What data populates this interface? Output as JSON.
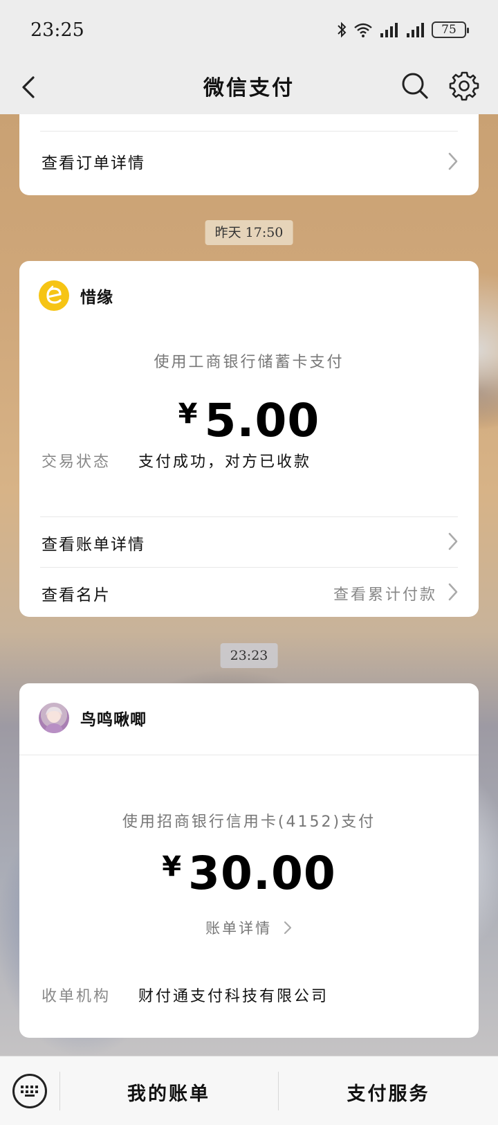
{
  "status_bar": {
    "time": "23:25",
    "battery": "75",
    "icons": [
      "bluetooth-icon",
      "wifi-icon",
      "signal-icon",
      "signal-icon"
    ]
  },
  "nav": {
    "title": "微信支付",
    "back_icon": "chevron-left-icon",
    "search_icon": "search-icon",
    "settings_icon": "gear-icon"
  },
  "card1": {
    "view_order": "查看订单详情"
  },
  "time1": "昨天 17:50",
  "card2": {
    "merchant": "惜缘",
    "pay_method": "使用工商银行储蓄卡支付",
    "currency": "¥",
    "amount": "5.00",
    "status_label": "交易状态",
    "status_value": "支付成功，对方已收款",
    "view_bill": "查看账单详情",
    "view_card": "查看名片",
    "view_total": "查看累计付款"
  },
  "time2": "23:23",
  "card3": {
    "merchant": "鸟鸣啾唧",
    "pay_method": "使用招商银行信用卡(4152)支付",
    "currency": "¥",
    "amount": "30.00",
    "bill_detail": "账单详情",
    "acquirer_label": "收单机构",
    "acquirer_value": "财付通支付科技有限公司"
  },
  "bottom_bar": {
    "my_bill": "我的账单",
    "pay_service": "支付服务",
    "keyboard_icon": "keyboard-icon"
  },
  "colors": {
    "merchant_logo": "#f6c414",
    "background": "#ededed"
  }
}
